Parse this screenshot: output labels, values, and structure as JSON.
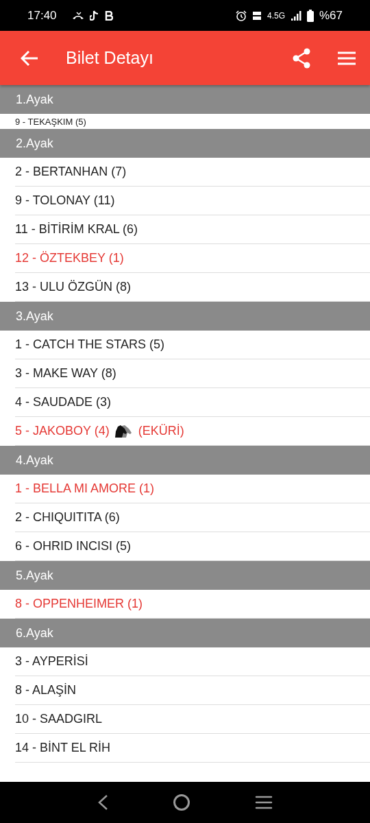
{
  "status_bar": {
    "time": "17:40",
    "network": "4.5G",
    "battery": "%67"
  },
  "app_bar": {
    "title": "Bilet Detayı"
  },
  "legs": [
    {
      "title": "1.Ayak",
      "partial": true,
      "horses": [
        {
          "text": "9 - TEKAŞKIM (5)",
          "highlighted": false
        }
      ]
    },
    {
      "title": "2.Ayak",
      "partial": false,
      "horses": [
        {
          "text": "2 - BERTANHAN (7)",
          "highlighted": false
        },
        {
          "text": "9 - TOLONAY (11)",
          "highlighted": false
        },
        {
          "text": "11 - BİTİRİM KRAL (6)",
          "highlighted": false
        },
        {
          "text": "12 - ÖZTEKBEY (1)",
          "highlighted": true
        },
        {
          "text": "13 - ULU ÖZGÜN (8)",
          "highlighted": false
        }
      ]
    },
    {
      "title": "3.Ayak",
      "partial": false,
      "horses": [
        {
          "text": "1 - CATCH THE STARS (5)",
          "highlighted": false
        },
        {
          "text": "3 - MAKE WAY (8)",
          "highlighted": false
        },
        {
          "text": "4 - SAUDADE (3)",
          "highlighted": false
        },
        {
          "text": "5 - JAKOBOY (4)",
          "highlighted": true,
          "note": "(EKÜRİ)"
        }
      ]
    },
    {
      "title": "4.Ayak",
      "partial": false,
      "horses": [
        {
          "text": "1 - BELLA MI AMORE (1)",
          "highlighted": true
        },
        {
          "text": "2 - CHIQUITITA (6)",
          "highlighted": false
        },
        {
          "text": "6 - OHRID INCISI (5)",
          "highlighted": false
        }
      ]
    },
    {
      "title": "5.Ayak",
      "partial": false,
      "horses": [
        {
          "text": "8 - OPPENHEIMER (1)",
          "highlighted": true
        }
      ]
    },
    {
      "title": "6.Ayak",
      "partial": false,
      "horses": [
        {
          "text": "3 - AYPERİSİ",
          "highlighted": false
        },
        {
          "text": "8 - ALAŞİN",
          "highlighted": false
        },
        {
          "text": "10 - SAADGIRL",
          "highlighted": false
        },
        {
          "text": "14 - BİNT EL RİH",
          "highlighted": false
        }
      ]
    }
  ]
}
